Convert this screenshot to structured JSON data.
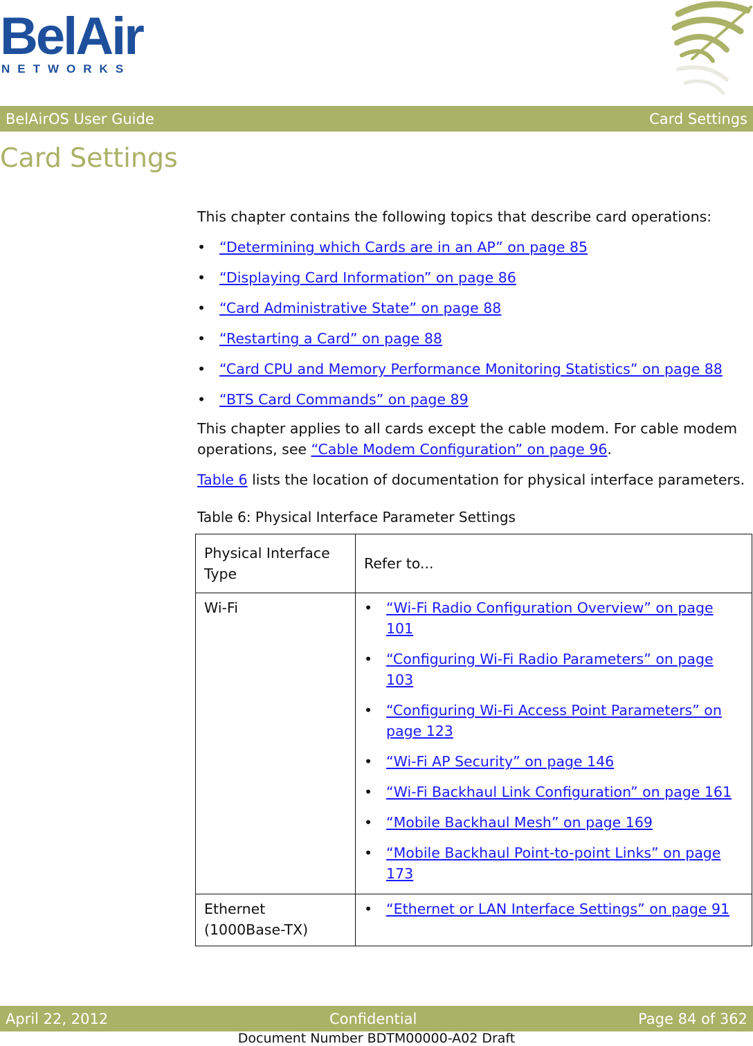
{
  "logo": {
    "wordmark": "BelAir",
    "subtitle": "NETWORKS"
  },
  "header": {
    "left": "BelAirOS User Guide",
    "right": "Card Settings"
  },
  "page_title": "Card Settings",
  "intro": "This chapter contains the following topics that describe card operations:",
  "topics": [
    {
      "label": "“Determining which Cards are in an AP” on page 85"
    },
    {
      "label": "“Displaying Card Information” on page 86"
    },
    {
      "label": "“Card Administrative State” on page 88"
    },
    {
      "label": "“Restarting a Card” on page 88"
    },
    {
      "label": "“Card CPU and Memory Performance Monitoring Statistics” on page 88"
    },
    {
      "label": "“BTS Card Commands” on page 89"
    }
  ],
  "para2": {
    "text": "This chapter applies to all cards except the cable modem. For cable modem operations, see ",
    "link": "“Cable Modem Configuration” on page 96",
    "after": "."
  },
  "para3": {
    "link": "Table 6",
    "text": " lists the location of documentation for physical interface parameters."
  },
  "table": {
    "caption": "Table 6: Physical Interface Parameter Settings",
    "headers": [
      "Physical Interface Type",
      "Refer to..."
    ],
    "rows": [
      {
        "type": "Wi-Fi",
        "refs": [
          "“Wi-Fi Radio Configuration Overview” on page 101",
          "“Configuring Wi-Fi Radio Parameters” on page 103",
          "“Configuring Wi-Fi Access Point Parameters” on page 123",
          "“Wi-Fi AP Security” on page 146",
          "“Wi-Fi Backhaul Link Configuration” on page 161",
          "“Mobile Backhaul Mesh” on page 169",
          "“Mobile Backhaul Point-to-point Links” on page 173"
        ]
      },
      {
        "type": "Ethernet (1000Base-TX)",
        "refs": [
          "“Ethernet or LAN Interface Settings” on page 91"
        ]
      }
    ]
  },
  "footer": {
    "date": "April 22, 2012",
    "classification": "Confidential",
    "page": "Page 84 of 362",
    "doc_number": "Document Number BDTM00000-A02 Draft"
  },
  "colors": {
    "accent": "#a9b266",
    "link": "#1a1aff",
    "logo": "#1d4f9c"
  }
}
